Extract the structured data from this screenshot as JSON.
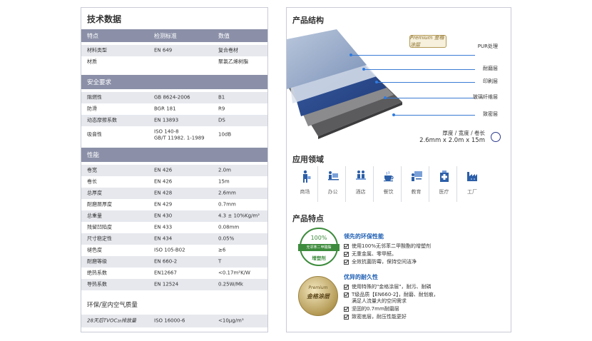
{
  "tech": {
    "title": "技术数据",
    "headers": [
      "特点",
      "检测标准",
      "数值"
    ],
    "basic_rows": [
      {
        "feature": "材料类型",
        "standard": "EN 649",
        "value": "复合卷材"
      },
      {
        "feature": "材质",
        "standard": "",
        "value": "聚氯乙烯树脂"
      }
    ],
    "safety_title": "安全要求",
    "safety_rows": [
      {
        "feature": "阻燃性",
        "standard": "GB 8624-2006",
        "value": "B1"
      },
      {
        "feature": "防滑",
        "standard": "BGR 181",
        "value": "R9"
      },
      {
        "feature": "动态摩擦系数",
        "standard": "EN 13893",
        "value": "DS"
      },
      {
        "feature": "吸音性",
        "standard": "ISO 140-8\nGB/T 11982. 1-1989",
        "value": "10dB"
      }
    ],
    "perf_title": "性能",
    "perf_rows": [
      {
        "feature": "卷宽",
        "standard": "EN 426",
        "value": "2.0m"
      },
      {
        "feature": "卷长",
        "standard": "EN 426",
        "value": "15m"
      },
      {
        "feature": "总厚度",
        "standard": "EN 428",
        "value": "2.6mm"
      },
      {
        "feature": "耐磨层厚度",
        "standard": "EN 429",
        "value": "0.7mm"
      },
      {
        "feature": "总重量",
        "standard": "EN 430",
        "value": "4.3 ± 10%Kg/m²"
      },
      {
        "feature": "残留凹陷度",
        "standard": "EN 433",
        "value": "0.08mm"
      },
      {
        "feature": "尺寸稳定性",
        "standard": "EN 434",
        "value": "0.05%"
      },
      {
        "feature": "褪色度",
        "standard": "ISO 105-B02",
        "value": "≥6"
      },
      {
        "feature": "耐磨等级",
        "standard": "EN 660-2",
        "value": "T"
      },
      {
        "feature": "绝热系数",
        "standard": "EN12667",
        "value": "<0.17m²K/W"
      },
      {
        "feature": "导热系数",
        "standard": "EN 12524",
        "value": "0.25W/Mk"
      }
    ],
    "env_title": "环保/室内空气质量",
    "env_rows": [
      {
        "feature": "28天后TVOC₂₈排放量",
        "standard": "ISO 16000-6",
        "value": "<10μg/m³"
      }
    ]
  },
  "structure": {
    "title": "产品结构",
    "badge_text": "Premium 金格涂层",
    "layers": [
      "PUR处理",
      "耐磨层",
      "印刷层",
      "玻璃纤维层",
      "致密层"
    ],
    "dims_label": "厚度 / 宽度 / 卷长",
    "dims_value": "2.6mm x 2.0m x 15m"
  },
  "applications": {
    "title": "应用领域",
    "items": [
      {
        "label": "商场",
        "icon": "shopping-icon"
      },
      {
        "label": "办公",
        "icon": "office-icon"
      },
      {
        "label": "酒店",
        "icon": "hotel-icon"
      },
      {
        "label": "餐饮",
        "icon": "dining-icon"
      },
      {
        "label": "教育",
        "icon": "education-icon"
      },
      {
        "label": "医疗",
        "icon": "medical-icon"
      },
      {
        "label": "工厂",
        "icon": "factory-icon"
      }
    ]
  },
  "features": {
    "title": "产品特点",
    "eco": {
      "seal_top": "100%",
      "seal_band": "无邻苯二甲酸酯",
      "seal_bottom": "增塑剂",
      "title": "领先的环保性能",
      "items": [
        "使用100%无邻苯二甲酸酯的增塑剂",
        "无重金属、零甲醛。",
        "全效抗菌防霉，保持空间洁净"
      ]
    },
    "durability": {
      "seal_top": "Premium",
      "seal_text": "金格涂层",
      "title": "优异的耐久性",
      "items": [
        "使用特殊的\"金格涂层\"，耐污、耐磷",
        "T级品质【EN660-2】，耐磨、耐划痕，\n满足人流量大的空间需求",
        "坚固的0.7mm耐磨层",
        "致密底层，耐压性能更好"
      ]
    }
  },
  "colors": {
    "header_bg": "#8b90a8",
    "row_alt": "#e6e8ee",
    "accent_blue": "#1f5fb3",
    "eco_green": "#3d8b3d",
    "gold": "#b49a55"
  }
}
